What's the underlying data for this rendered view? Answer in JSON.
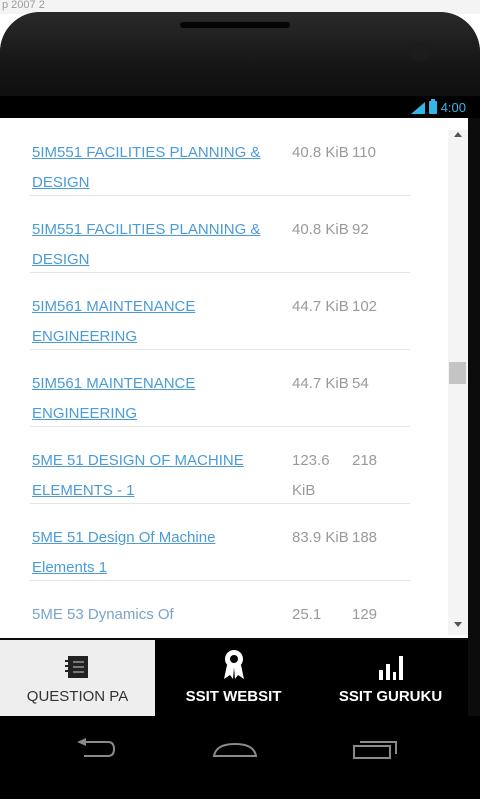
{
  "caption": "p 2007 2",
  "status_bar": {
    "time": "4:00"
  },
  "files": [
    {
      "title": "5IM551 FACILITIES PLANNING & DESIGN",
      "size": "40.8 KiB",
      "count": "110"
    },
    {
      "title": "5IM551 FACILITIES PLANNING & DESIGN",
      "size": "40.8 KiB",
      "count": "92"
    },
    {
      "title": "5IM561 MAINTENANCE ENGINEERING",
      "size": "44.7 KiB",
      "count": "102"
    },
    {
      "title": "5IM561 MAINTENANCE ENGINEERING",
      "size": "44.7 KiB",
      "count": "54"
    },
    {
      "title": "5ME 51 DESIGN OF MACHINE ELEMENTS - 1",
      "size": "123.6 KiB",
      "count": "218"
    },
    {
      "title": "5ME 51 Design Of Machine Elements 1",
      "size": "83.9 KiB",
      "count": "188"
    },
    {
      "title": "5ME 53 Dynamics Of",
      "size": "25.1",
      "count": "129"
    }
  ],
  "bottom_tabs": [
    {
      "label": "QUESTION PA",
      "icon": "document-icon",
      "active": true
    },
    {
      "label": "SSIT WEBSIT",
      "icon": "award-ribbon-icon",
      "active": false
    },
    {
      "label": "SSIT GURUKU",
      "icon": "bar-chart-icon",
      "active": false
    }
  ],
  "system_nav": [
    "back-icon",
    "home-icon",
    "recent-apps-icon"
  ],
  "colors": {
    "link": "#4a9bd8",
    "accent": "#33b5e5",
    "muted": "#9a9a9a"
  }
}
